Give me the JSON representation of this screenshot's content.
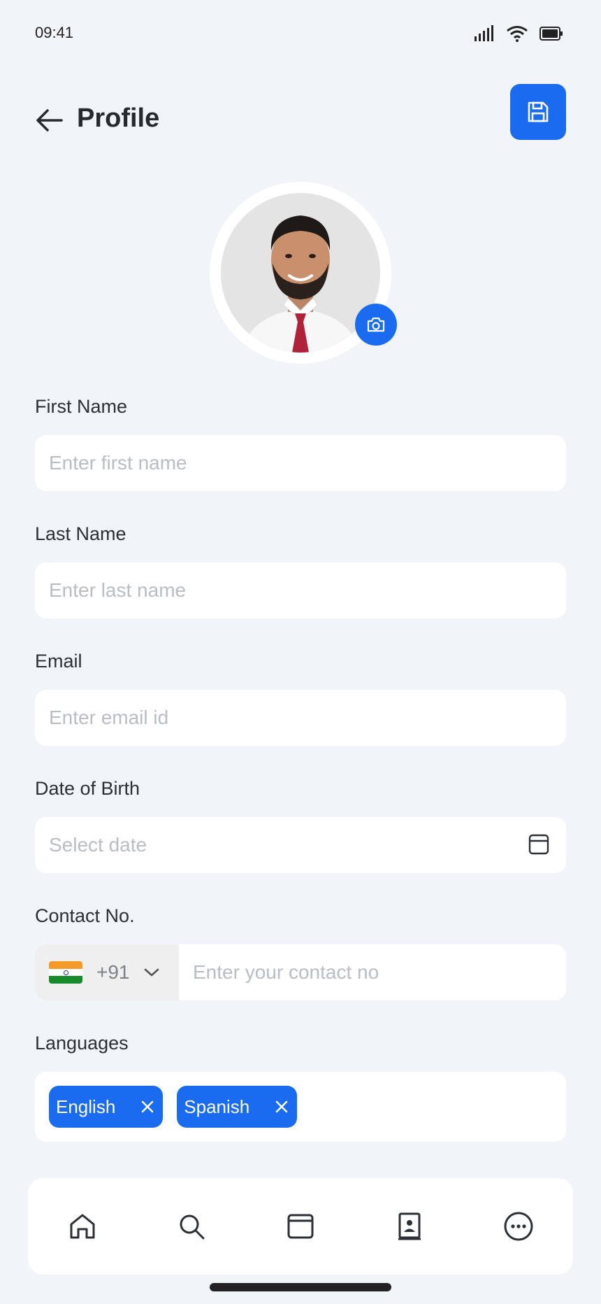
{
  "status_bar": {
    "time": "09:41"
  },
  "header": {
    "title": "Profile",
    "back_icon": "arrow-left-icon",
    "save_icon": "floppy-disk-icon"
  },
  "colors": {
    "accent": "#1a6bf0",
    "background": "#f1f4f9",
    "field": "#ffffff",
    "placeholder": "#b9bdc4"
  },
  "form": {
    "first_name": {
      "label": "First Name",
      "placeholder": "Enter first name",
      "value": ""
    },
    "last_name": {
      "label": "Last Name",
      "placeholder": "Enter last name",
      "value": ""
    },
    "email": {
      "label": "Email",
      "placeholder": "Enter email id",
      "value": ""
    },
    "dob": {
      "label": "Date of Birth",
      "placeholder": "Select date",
      "icon": "calendar-icon"
    },
    "contact": {
      "label": "Contact No.",
      "country_code": "+91",
      "country_flag": "india-flag-icon",
      "placeholder": "Enter your contact no",
      "value": ""
    },
    "languages": {
      "label": "Languages",
      "items": [
        "English",
        "Spanish"
      ]
    }
  },
  "bottom_nav": [
    "home-icon",
    "search-icon",
    "browser-icon",
    "contacts-book-icon",
    "more-icon"
  ]
}
